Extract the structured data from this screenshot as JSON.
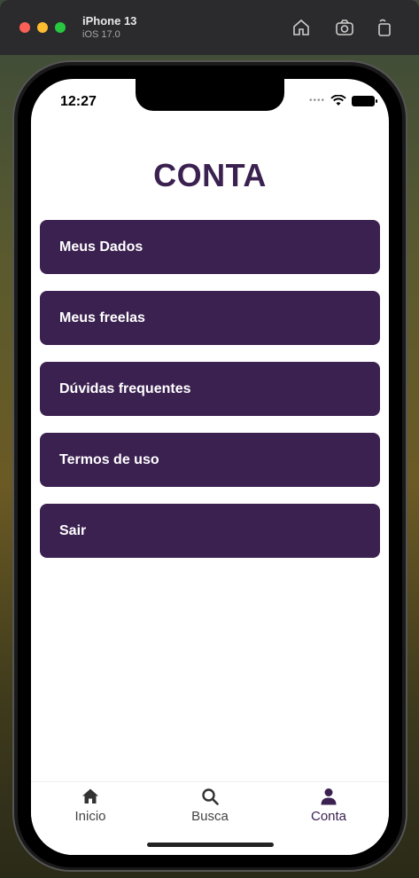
{
  "simulator": {
    "device_name": "iPhone 13",
    "os_version": "iOS 17.0"
  },
  "status_bar": {
    "time": "12:27"
  },
  "page": {
    "title": "CONTA"
  },
  "menu": {
    "items": [
      {
        "label": "Meus Dados"
      },
      {
        "label": "Meus freelas"
      },
      {
        "label": "Dúvidas frequentes"
      },
      {
        "label": "Termos de uso"
      },
      {
        "label": "Sair"
      }
    ]
  },
  "tabbar": {
    "items": [
      {
        "label": "Inicio",
        "icon": "home-icon"
      },
      {
        "label": "Busca",
        "icon": "search-icon"
      },
      {
        "label": "Conta",
        "icon": "user-icon",
        "active": true
      }
    ]
  },
  "colors": {
    "primary": "#3b2150",
    "background": "#ffffff"
  }
}
